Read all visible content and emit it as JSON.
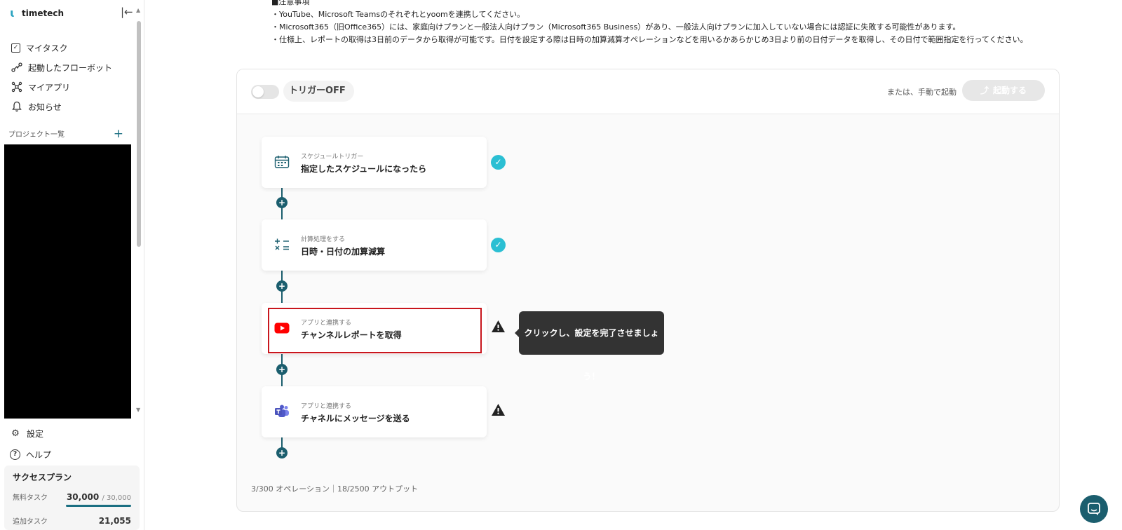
{
  "app": {
    "name": "timetech",
    "icons": {
      "logo": "timetech-logo-icon",
      "collapse": "collapse-sidebar-icon"
    }
  },
  "sidebar": {
    "nav": [
      {
        "label": "マイタスク",
        "icon": "checkbox-icon"
      },
      {
        "label": "起動したフローボット",
        "icon": "flow-icon"
      },
      {
        "label": "マイアプリ",
        "icon": "apps-network-icon"
      },
      {
        "label": "お知らせ",
        "icon": "bell-icon"
      }
    ],
    "projects_label": "プロジェクト一覧",
    "projects_add": "+",
    "bottom": [
      {
        "label": "設定",
        "icon": "gear-icon"
      },
      {
        "label": "ヘルプ",
        "icon": "help-icon"
      }
    ],
    "plan": {
      "title": "サクセスプラン",
      "free_tasks_label": "無料タスク",
      "free_tasks_value": "30,000",
      "free_tasks_max": "/ 30,000",
      "free_tasks_fill": 1.0,
      "extra_tasks_label": "追加タスク",
      "extra_tasks_value": "21,055"
    }
  },
  "notes": [
    "■注意事項",
    "・YouTube、Microsoft Teamsのそれぞれとyoomを連携してください。",
    "・Microsoft365（旧Office365）には、家庭向けプランと一般法人向けプラン（Microsoft365 Business）があり、一般法人向けプランに加入していない場合には認証に失敗する可能性があります。",
    "・仕様上、レポートの取得は3日前のデータから取得が可能です。日付を設定する際は日時の加算減算オペレーションなどを用いるかあらかじめ3日より前の日付データを取得し、その日付で範囲指定を行ってください。"
  ],
  "flow": {
    "trigger_toggle_label": "トリガーOFF",
    "trigger_on": false,
    "manual_label": "または、手動で起動",
    "start_button": "起動する",
    "steps": [
      {
        "subtitle": "スケジュールトリガー",
        "title": "指定したスケジュールになったら",
        "icon": "calendar-schedule-icon",
        "status": "complete"
      },
      {
        "subtitle": "計算処理をする",
        "title": "日時・日付の加算減算",
        "icon": "calculator-operators-icon",
        "status": "complete"
      },
      {
        "subtitle": "アプリと連携する",
        "title": "チャンネルレポートを取得",
        "icon": "youtube-icon",
        "status": "warning"
      },
      {
        "subtitle": "アプリと連携する",
        "title": "チャネルにメッセージを送る",
        "icon": "microsoft-teams-icon",
        "status": "warning"
      }
    ],
    "tooltip": "クリックし、設定を完了させましょう！",
    "stats": "3/300 オペレーション｜18/2500 アウトプット"
  },
  "colors": {
    "accent": "#1b5e6e",
    "check": "#2bbfd3",
    "highlight": "#c8161d",
    "youtube": "#ff0000",
    "teams": "#5059c9"
  }
}
